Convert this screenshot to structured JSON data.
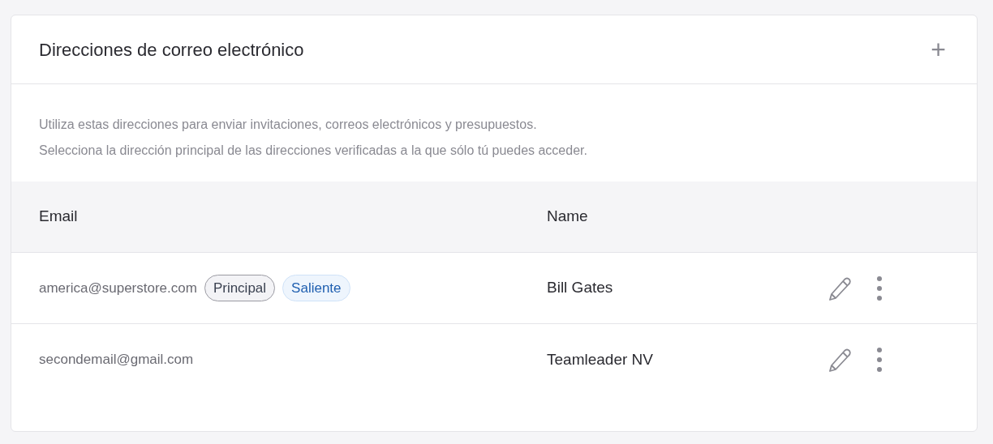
{
  "card": {
    "title": "Direcciones de correo electrónico",
    "add_button": "+"
  },
  "description": [
    "Utiliza estas direcciones para enviar invitaciones, correos electrónicos y presupuestos.",
    "Selecciona la dirección principal de las direcciones verificadas a la que sólo tú puedes acceder."
  ],
  "table": {
    "columns": [
      "Email",
      "Name"
    ],
    "rows": [
      {
        "email": "america@superstore.com",
        "badges": [
          {
            "label": "Principal",
            "kind": "neutral"
          },
          {
            "label": "Saliente",
            "kind": "info"
          }
        ],
        "name": "Bill Gates"
      },
      {
        "email": "secondemail@gmail.com",
        "badges": [],
        "name": "Teamleader NV"
      }
    ]
  }
}
